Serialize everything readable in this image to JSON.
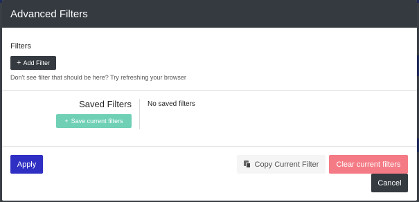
{
  "modal": {
    "title": "Advanced Filters",
    "filters_label": "Filters",
    "add_filter_label": "Add Filter",
    "hint": "Don't see filter that should be here? Try refreshing your browser",
    "saved_filters_title": "Saved Filters",
    "save_current_label": "Save current filters",
    "no_saved_text": "No saved filters",
    "apply_label": "Apply",
    "copy_label": "Copy Current Filter",
    "clear_label": "Clear current filters",
    "cancel_label": "Cancel"
  },
  "icons": {
    "add": "plus-icon",
    "save": "plus-icon",
    "copy": "copy-icon"
  },
  "colors": {
    "header": "#343a40",
    "apply": "#2f2fc3",
    "save": "#6fd0b6",
    "clear": "#f47b85",
    "cancel": "#343a40"
  }
}
